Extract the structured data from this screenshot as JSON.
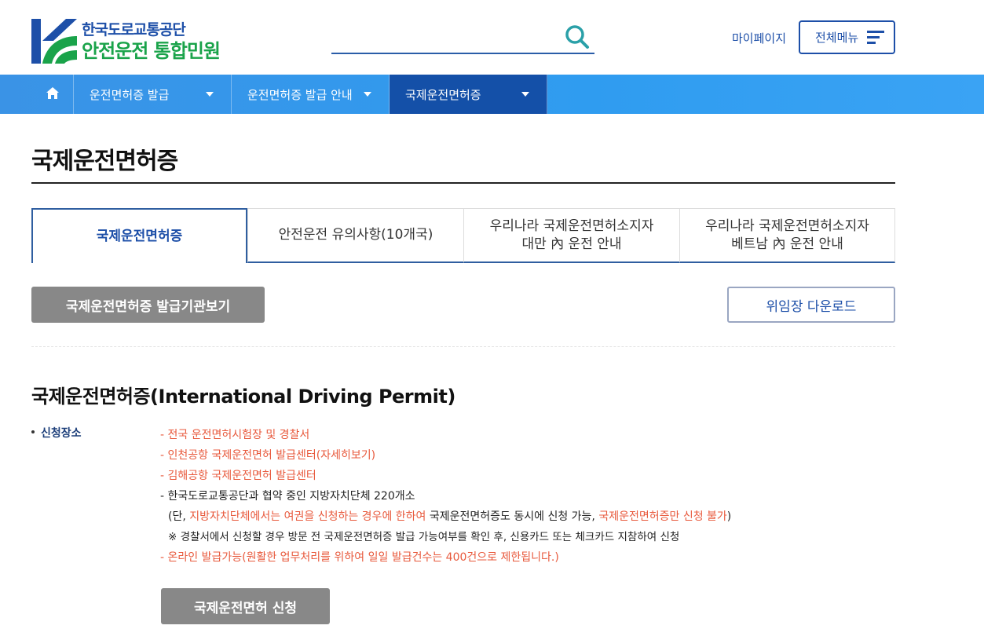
{
  "logo": {
    "line1": "한국도로교통공단",
    "line2": "안전운전 통합민원"
  },
  "header": {
    "mypage_label": "마이페이지",
    "allmenu_label": "전체메뉴",
    "search_placeholder": ""
  },
  "gnb": {
    "items": [
      {
        "label": "운전면허증 발급"
      },
      {
        "label": "운전면허증 발급 안내"
      },
      {
        "label": "국제운전면허증"
      }
    ]
  },
  "page": {
    "title": "국제운전면허증"
  },
  "tabs": [
    {
      "line1": "국제운전면허증",
      "line2": ""
    },
    {
      "line1": "안전운전 유의사항(10개국)",
      "line2": ""
    },
    {
      "line1": "우리나라 국제운전면허소지자",
      "line2": "대만 內 운전 안내"
    },
    {
      "line1": "우리나라 국제운전면허소지자",
      "line2": "베트남 內 운전 안내"
    }
  ],
  "buttons": {
    "issuer_view": "국제운전면허증 발급기관보기",
    "proxy_download": "위임장 다운로드",
    "apply": "국제운전면허 신청"
  },
  "section": {
    "title": "국제운전면허증(International Driving Permit)",
    "label": "신청장소",
    "lines": {
      "l1": "- 전국 운전면허시험장 및 경찰서",
      "l2": "- 인천공항 국제운전면허 발급센터(자세히보기)",
      "l3": "- 김해공항 국제운전면허 발급센터",
      "l4": "- 한국도로교통공단과 협약 중인 지방자치단체 220개소",
      "l5a": "(단, ",
      "l5b": "지방자치단체에서는 여권을 신청하는 경우에 한하여",
      "l5c": " 국제운전면허증도 동시에 신청 가능, ",
      "l5d": "국제운전면허증만 신청 불가",
      "l5e": ")",
      "l6": "※ 경찰서에서 신청할 경우 방문 전 국제운전면허증 발급 가능여부를 확인 후, 신용카드 또는 체크카드 지참하여 신청",
      "l7": "- 온라인 발급가능(원활한 업무처리를 위하여 일일 발급건수는 400건으로 제한됩니다.)"
    }
  },
  "colors": {
    "brand_blue": "#1d4fa8",
    "brand_green": "#1aa34a",
    "gnb_blue": "#2f9cf0",
    "gnb_active": "#1450a8",
    "accent_red": "#e8593c",
    "button_gray": "#888888"
  }
}
